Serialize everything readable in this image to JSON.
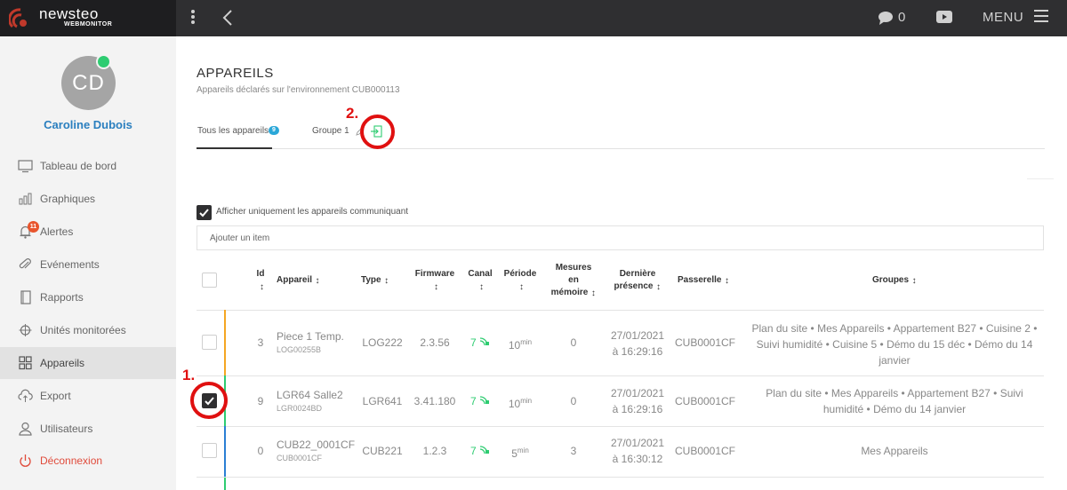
{
  "app": {
    "logo_name": "newsteo",
    "logo_subtitle": "WEBMONITOR"
  },
  "topbar": {
    "chat_count": "0",
    "menu_label": "MENU"
  },
  "user": {
    "initials": "CD",
    "name": "Caroline Dubois"
  },
  "sidebar": {
    "items": [
      {
        "label": "Tableau de bord",
        "icon": "monitor-icon"
      },
      {
        "label": "Graphiques",
        "icon": "bar-chart-icon"
      },
      {
        "label": "Alertes",
        "icon": "bell-icon",
        "badge": "11"
      },
      {
        "label": "Evénements",
        "icon": "paperclip-icon"
      },
      {
        "label": "Rapports",
        "icon": "document-icon"
      },
      {
        "label": "Unités monitorées",
        "icon": "crosshair-icon"
      },
      {
        "label": "Appareils",
        "icon": "grid-icon",
        "active": true
      },
      {
        "label": "Export",
        "icon": "cloud-upload-icon"
      },
      {
        "label": "Utilisateurs",
        "icon": "user-icon"
      },
      {
        "label": "Déconnexion",
        "icon": "power-icon"
      }
    ]
  },
  "page": {
    "title": "APPAREILS",
    "subtitle": "Appareils déclarés sur l'environnement CUB000113"
  },
  "tabs": {
    "all_label": "Tous les appareils",
    "all_count": "9",
    "group_label": "Groupe 1"
  },
  "annotations": {
    "step1": "1.",
    "step2": "2."
  },
  "filter": {
    "label": "Afficher uniquement les appareils communiquant"
  },
  "search": {
    "placeholder": "Ajouter un item"
  },
  "table": {
    "headers": {
      "id": "Id",
      "appareil": "Appareil",
      "type": "Type",
      "firmware": "Firmware",
      "canal": "Canal",
      "periode": "Période",
      "mesures_1": "Mesures",
      "mesures_2": "en",
      "mesures_3": "mémoire",
      "presence_1": "Dernière",
      "presence_2": "présence",
      "passerelle": "Passerelle",
      "groupes": "Groupes"
    },
    "rows": [
      {
        "id": "3",
        "name": "Piece 1 Temp.",
        "serial": "LOG00255B",
        "type": "LOG222",
        "firmware": "2.3.56",
        "canal": "7",
        "period": "10",
        "period_unit": "min",
        "mesures": "0",
        "date": "27/01/2021",
        "time": "à 16:29:16",
        "gateway": "CUB0001CF",
        "groups_1": "Plan du site • Mes Appareils • Appartement B27 • Cuisine 2 •",
        "groups_2": "Suivi humidité • Cuisine 5 • Démo du 15 déc • Démo du 14",
        "groups_3": "janvier",
        "checked": false,
        "accent": "#f5a623"
      },
      {
        "id": "9",
        "name": "LGR64 Salle2",
        "serial": "LGR0024BD",
        "type": "LGR641",
        "firmware": "3.41.180",
        "canal": "7",
        "period": "10",
        "period_unit": "min",
        "mesures": "0",
        "date": "27/01/2021",
        "time": "à 16:29:16",
        "gateway": "CUB0001CF",
        "groups_1": "Plan du site • Mes Appareils • Appartement B27 • Suivi",
        "groups_2": "humidité • Démo du 14 janvier",
        "checked": true,
        "accent": "#2ecc71"
      },
      {
        "id": "0",
        "name": "CUB22_0001CF",
        "serial": "CUB0001CF",
        "type": "CUB221",
        "firmware": "1.2.3",
        "canal": "7",
        "period": "5",
        "period_unit": "min",
        "mesures": "3",
        "date": "27/01/2021",
        "time": "à 16:30:12",
        "gateway": "CUB0001CF",
        "groups_1": "Mes Appareils",
        "checked": false,
        "accent": "#2a7fd4"
      }
    ]
  },
  "colors": {
    "accent_blue": "#2aa7d8",
    "online_green": "#2ecc71",
    "highlight_red": "#e01010"
  }
}
